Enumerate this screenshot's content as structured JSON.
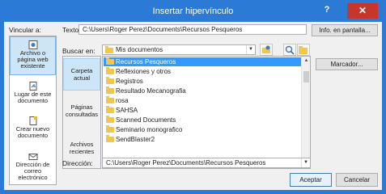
{
  "window": {
    "title": "Insertar hipervínculo",
    "help": "?",
    "close": "✕"
  },
  "left": {
    "link_to_label": "Vincular a:",
    "items": [
      {
        "label": "Archivo o página web existente",
        "selected": true
      },
      {
        "label": "Lugar de este documento"
      },
      {
        "label": "Crear nuevo documento"
      },
      {
        "label": "Dirección de correo electrónico"
      }
    ]
  },
  "text_row": {
    "label": "Texto:",
    "value": "C:\\Users\\Roger Perez\\Documents\\Recursos Pesqueros",
    "tooltip_button": "Info. en pantalla..."
  },
  "search": {
    "label": "Buscar en:",
    "value": "Mis documentos"
  },
  "places": [
    {
      "label": "Carpeta actual",
      "selected": true
    },
    {
      "label": "Páginas consultadas"
    },
    {
      "label": "Archivos recientes"
    }
  ],
  "files": [
    "Recursos Pesqueros",
    "Reflexiones y otros",
    "Registros",
    "Resultado Mecanografia",
    "rosa",
    "SAHSA",
    "Scanned Documents",
    "Seminario monografico",
    "SendBlaster2"
  ],
  "selected_file": 0,
  "bookmark_button": "Marcador...",
  "address": {
    "label": "Dirección:",
    "value": "C:\\Users\\Roger Perez\\Documents\\Recursos Pesqueros"
  },
  "ok_button": "Aceptar",
  "cancel_button": "Cancelar",
  "icons": {
    "nav": [
      "web-page-icon",
      "place-in-document-icon",
      "new-document-icon",
      "email-icon"
    ],
    "toolbar": [
      "browse-web-icon",
      "search-folder-icon",
      "open-file-icon"
    ]
  }
}
